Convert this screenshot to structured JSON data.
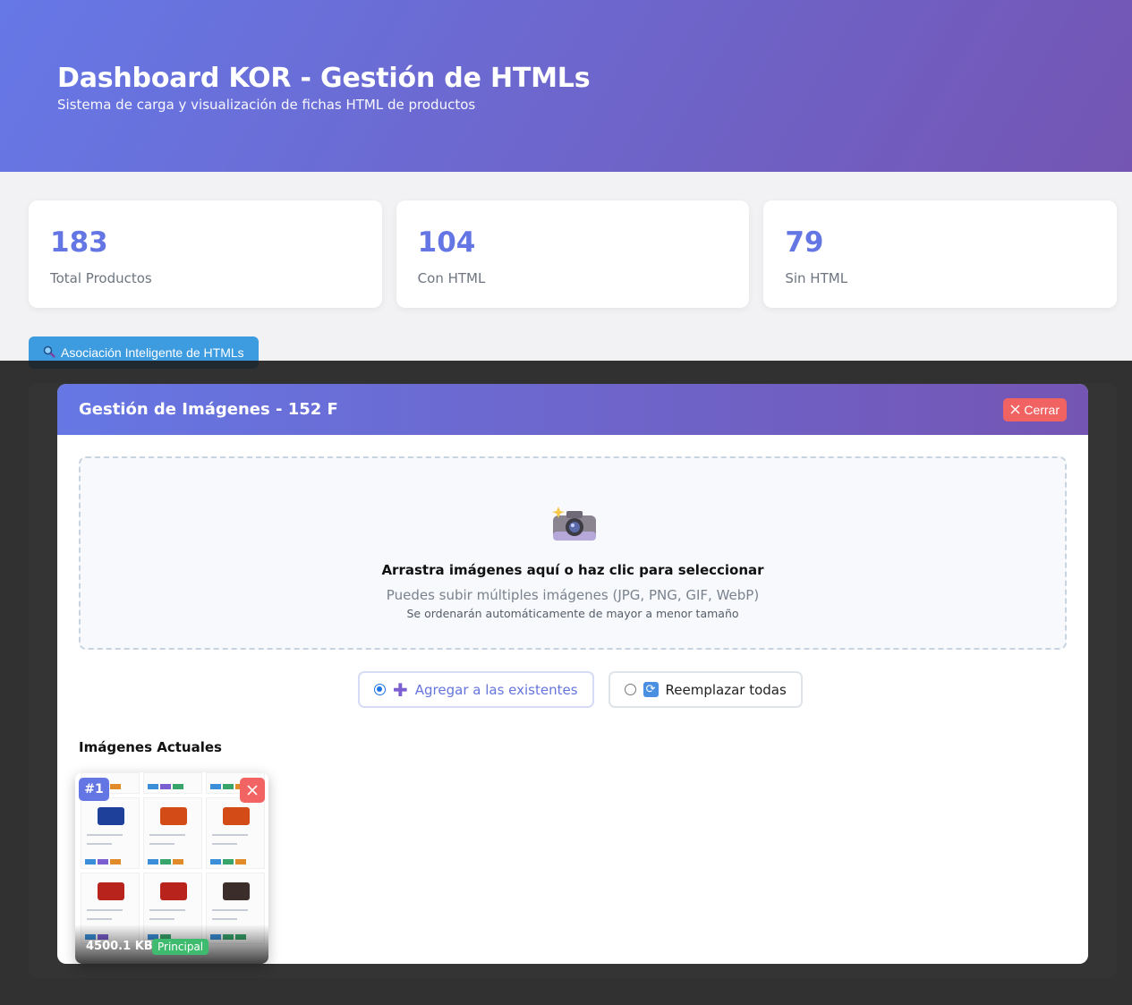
{
  "header": {
    "title": "Dashboard KOR - Gestión de HTMLs",
    "subtitle": "Sistema de carga y visualización de fichas HTML de productos"
  },
  "stats": [
    {
      "value": "183",
      "label": "Total Productos"
    },
    {
      "value": "104",
      "label": "Con HTML"
    },
    {
      "value": "79",
      "label": "Sin HTML"
    }
  ],
  "assoc_button": {
    "icon": "magnifier-icon",
    "label": "Asociación Inteligente de HTMLs"
  },
  "modal": {
    "title": "Gestión de Imágenes - 152 F",
    "close_label": "Cerrar",
    "dropzone": {
      "icon": "camera-flash-icon",
      "title": "Arrastra imágenes aquí o haz clic para seleccionar",
      "subtitle": "Puedes subir múltiples imágenes (JPG, PNG, GIF, WebP)",
      "note": "Se ordenarán automáticamente de mayor a menor tamaño"
    },
    "options": [
      {
        "label": "Agregar a las existentes",
        "icon": "plus-icon",
        "selected": true
      },
      {
        "label": "Reemplazar todas",
        "icon": "refresh-icon",
        "selected": false
      }
    ],
    "current_title": "Imágenes Actuales",
    "images": [
      {
        "index": "#1",
        "size": "4500.1 KB",
        "badge": "Principal"
      }
    ]
  },
  "colors": {
    "accent": "#6476e4",
    "header_start": "#6678e6",
    "header_end": "#7455b3",
    "danger": "#f16363",
    "success": "#3ebb6e",
    "info": "#3d9be0"
  }
}
